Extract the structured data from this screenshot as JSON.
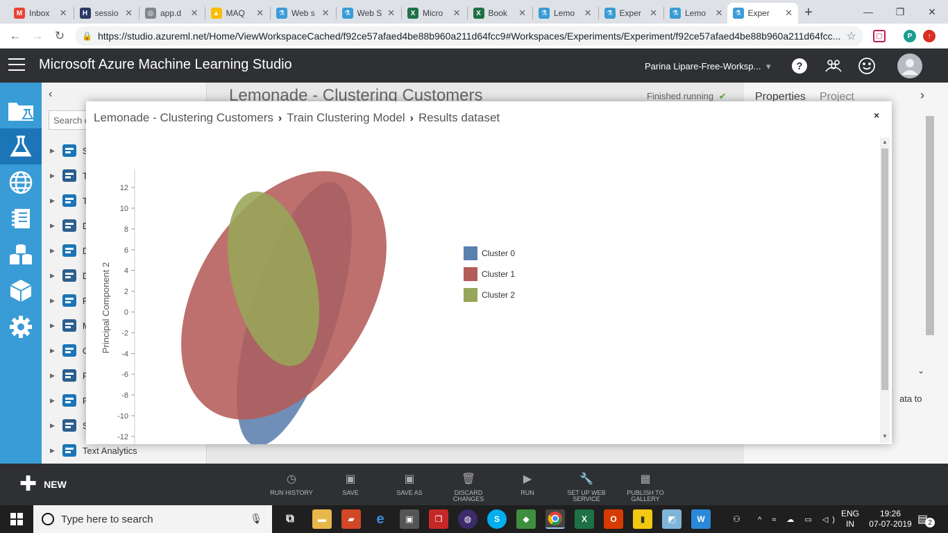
{
  "browser": {
    "tabs": [
      {
        "title": "Inbox",
        "favicon": "gmail-icon",
        "color": "#ea4335",
        "glyph": "M"
      },
      {
        "title": "sessio",
        "favicon": "hackerearth-icon",
        "color": "#2b3a67",
        "glyph": "H"
      },
      {
        "title": "app.d",
        "favicon": "globe-icon",
        "color": "#80868b",
        "glyph": "◎"
      },
      {
        "title": "MAQ",
        "favicon": "drive-icon",
        "color": "#fbbc04",
        "glyph": "▲"
      },
      {
        "title": "Web s",
        "favicon": "flask-icon",
        "color": "#3a9cd6",
        "glyph": "⚗"
      },
      {
        "title": "Web S",
        "favicon": "flask-icon",
        "color": "#3a9cd6",
        "glyph": "⚗"
      },
      {
        "title": "Micro",
        "favicon": "excel-icon",
        "color": "#1e7145",
        "glyph": "X"
      },
      {
        "title": "Book",
        "favicon": "excel-icon",
        "color": "#1e7145",
        "glyph": "X"
      },
      {
        "title": "Lemo",
        "favicon": "flask-icon",
        "color": "#3a9cd6",
        "glyph": "⚗"
      },
      {
        "title": "Exper",
        "favicon": "flask-icon",
        "color": "#3a9cd6",
        "glyph": "⚗"
      },
      {
        "title": "Lemo",
        "favicon": "flask-icon",
        "color": "#3a9cd6",
        "glyph": "⚗"
      },
      {
        "title": "Exper",
        "favicon": "flask-icon",
        "color": "#3a9cd6",
        "glyph": "⚗",
        "active": true
      }
    ],
    "url": "https://studio.azureml.net/Home/ViewWorkspaceCached/f92ce57afaed4be88b960a211d64fcc9#Workspaces/Experiments/Experiment/f92ce57afaed4be88b960a211d64fcc...",
    "profile_initial": "P"
  },
  "app": {
    "title": "Microsoft Azure Machine Learning Studio",
    "workspace": "Parina Lipare-Free-Worksp...",
    "workspace_caret": "▾"
  },
  "palette": {
    "search_placeholder": "Search e",
    "items": [
      {
        "label": "S",
        "icon": "dataset-icon"
      },
      {
        "label": "T",
        "icon": "cube-icon"
      },
      {
        "label": "T",
        "icon": "transform-icon"
      },
      {
        "label": "D",
        "icon": "data-input-icon"
      },
      {
        "label": "D",
        "icon": "data-format-icon"
      },
      {
        "label": "D",
        "icon": "data-transform-icon"
      },
      {
        "label": "F",
        "icon": "feature-selection-icon"
      },
      {
        "label": "M",
        "icon": "machine-learning-icon"
      },
      {
        "label": "C",
        "icon": "opencv-icon"
      },
      {
        "label": "P",
        "icon": "python-icon"
      },
      {
        "label": "R",
        "icon": "r-language-icon"
      },
      {
        "label": "S",
        "icon": "statistics-icon"
      },
      {
        "label": "Text Analytics",
        "icon": "text-analytics-icon"
      }
    ]
  },
  "canvas": {
    "experiment_title": "Lemonade - Clustering Customers",
    "status": "Finished running",
    "properties_tab": "Properties",
    "project_tab": "Project",
    "properties_text": "ata to"
  },
  "modal": {
    "crumbs": [
      "Lemonade - Clustering Customers",
      "Train Clustering Model",
      "Results dataset"
    ],
    "close": "×"
  },
  "chart_data": {
    "type": "scatter",
    "subtype": "cluster-ellipses",
    "ylabel": "Principal Component 2",
    "xlabel": "",
    "yticks": [
      12,
      10,
      8,
      6,
      4,
      2,
      0,
      -2,
      -4,
      -6,
      -8,
      -10,
      -12
    ],
    "ylim": [
      -12.6,
      13.8
    ],
    "legend_position": "right",
    "series": [
      {
        "name": "Cluster 0",
        "color": "#5b7fae",
        "center_y": -0.2,
        "y_extent": [
          -12.6,
          13.8
        ],
        "rotation_deg": 17
      },
      {
        "name": "Cluster 1",
        "color": "#b45c59",
        "center_y": 1.6,
        "y_extent": [
          -12.0,
          11.2
        ],
        "rotation_deg": 32
      },
      {
        "name": "Cluster 2",
        "color": "#97a658",
        "center_y": 3.2,
        "y_extent": [
          -8.9,
          8.5
        ],
        "rotation_deg": -14
      }
    ]
  },
  "commands": [
    {
      "label": "RUN HISTORY",
      "icon": "clock-icon"
    },
    {
      "label": "SAVE",
      "icon": "save-icon"
    },
    {
      "label": "SAVE AS",
      "icon": "save-as-icon"
    },
    {
      "label": "DISCARD CHANGES",
      "icon": "trash-icon"
    },
    {
      "label": "RUN",
      "icon": "play-icon"
    },
    {
      "label": "SET UP WEB SERVICE",
      "icon": "wrench-globe-icon"
    },
    {
      "label": "PUBLISH TO GALLERY",
      "icon": "gallery-icon"
    }
  ],
  "new_button": "NEW",
  "taskbar": {
    "search_placeholder": "Type here to search",
    "lang_line1": "ENG",
    "lang_line2": "IN",
    "time": "19:26",
    "date": "07-07-2019",
    "notifications": "2"
  }
}
